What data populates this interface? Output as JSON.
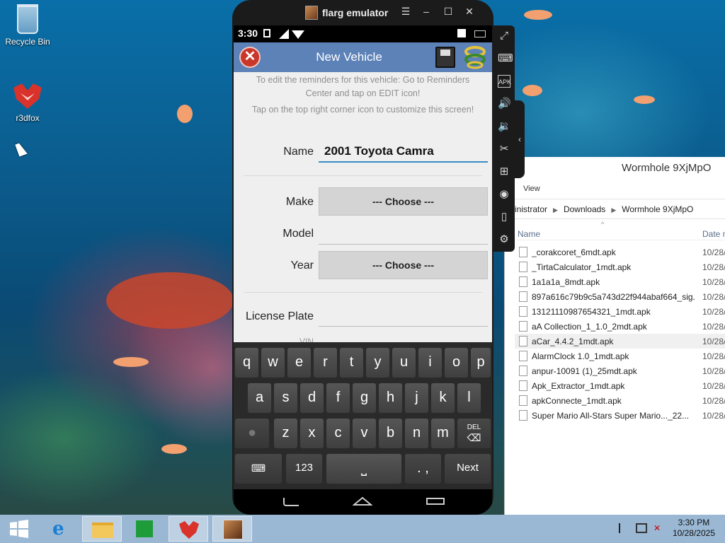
{
  "desktop": {
    "icons": [
      {
        "label": "Recycle Bin",
        "icon": "recycle-bin-icon"
      },
      {
        "label": "r3dfox",
        "icon": "r3dfox-icon"
      }
    ]
  },
  "emulator": {
    "title": "flarg emulator",
    "controls": [
      "menu-icon",
      "minimize-icon",
      "maximize-icon",
      "close-icon"
    ],
    "status_time": "3:30",
    "app": {
      "title": "New Vehicle",
      "hint1": "To edit the reminders for this vehicle: Go to Reminders Center and tap on EDIT icon!",
      "hint2": "Tap on the top right corner icon to customize this screen!",
      "name_label": "Name",
      "name_value": "2001 Toyota Camra",
      "make_label": "Make",
      "make_choose": "--- Choose ---",
      "model_label": "Model",
      "model_value": "",
      "year_label": "Year",
      "year_choose": "--- Choose ---",
      "plate_label": "License Plate",
      "plate_value": "",
      "vin_label": "VIN"
    },
    "keyboard": {
      "row1": [
        "q",
        "w",
        "e",
        "r",
        "t",
        "y",
        "u",
        "i",
        "o",
        "p"
      ],
      "row2": [
        "a",
        "s",
        "d",
        "f",
        "g",
        "h",
        "j",
        "k",
        "l"
      ],
      "row3": [
        "z",
        "x",
        "c",
        "v",
        "b",
        "n",
        "m"
      ],
      "del_label": "DEL",
      "num_label": "123",
      "comma_period": ". ,",
      "next_label": "Next"
    },
    "side_tools": [
      "fullscreen-icon",
      "keyboard-icon",
      "apk-icon",
      "volume-up-icon",
      "volume-down-icon",
      "cut-icon",
      "add-icon",
      "location-icon",
      "vibrate-icon",
      "settings-icon"
    ]
  },
  "explorer": {
    "title": "Wormhole 9XjMpO",
    "ribbon_tab": "View",
    "breadcrumb": [
      "inistrator",
      "Downloads",
      "Wormhole 9XjMpO"
    ],
    "col_name": "Name",
    "col_date": "Date m",
    "files": [
      {
        "name": "_corakcoret_6mdt.apk",
        "date": "10/28/"
      },
      {
        "name": "_TirtaCalculator_1mdt.apk",
        "date": "10/28/"
      },
      {
        "name": "1a1a1a_8mdt.apk",
        "date": "10/28/"
      },
      {
        "name": "897a616c79b9c5a743d22f944abaf664_sig...",
        "date": "10/28/"
      },
      {
        "name": "13121110987654321_1mdt.apk",
        "date": "10/28/"
      },
      {
        "name": "aA Collection_1_1.0_2mdt.apk",
        "date": "10/28/"
      },
      {
        "name": "aCar_4.4.2_1mdt.apk",
        "date": "10/28/",
        "selected": true
      },
      {
        "name": "AlarmClock 1.0_1mdt.apk",
        "date": "10/28/"
      },
      {
        "name": "anpur-10091 (1)_25mdt.apk",
        "date": "10/28/"
      },
      {
        "name": "Apk_Extractor_1mdt.apk",
        "date": "10/28/"
      },
      {
        "name": "apkConnecte_1mdt.apk",
        "date": "10/28/"
      },
      {
        "name": "Super Mario All-Stars  Super Mario..._22...",
        "date": "10/28/"
      }
    ]
  },
  "taskbar": {
    "items": [
      "start-icon",
      "internet-explorer-icon",
      "file-explorer-icon",
      "store-icon",
      "r3dfox-icon",
      "flarg-emulator-icon"
    ],
    "time": "3:30 PM",
    "date": "10/28/2025"
  }
}
